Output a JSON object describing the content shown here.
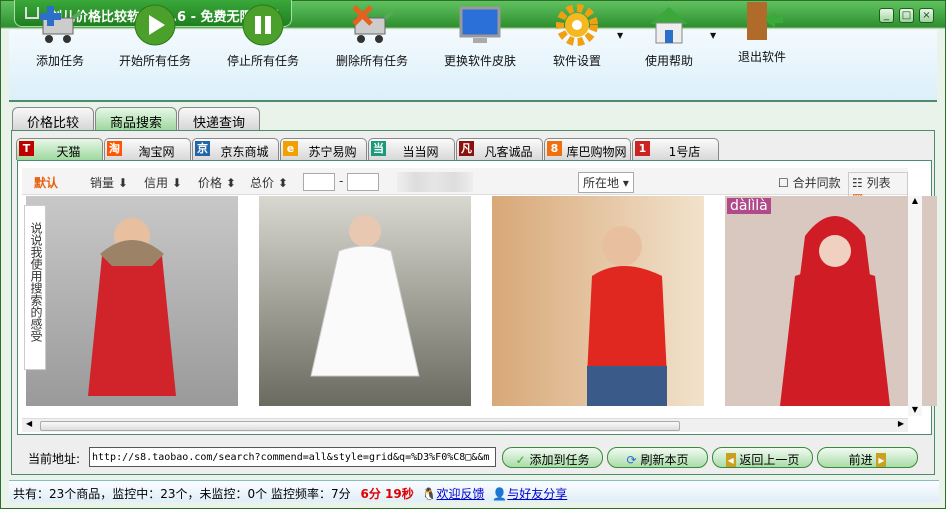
{
  "window": {
    "title": "剑儿价格比较软件V2.6  -  免费无限制版本",
    "min": "_",
    "max": "□",
    "close": "×"
  },
  "toolbar": [
    {
      "label": "添加任务",
      "icon": "add-cart-icon"
    },
    {
      "label": "开始所有任务",
      "icon": "play-icon"
    },
    {
      "label": "停止所有任务",
      "icon": "pause-icon"
    },
    {
      "label": "删除所有任务",
      "icon": "delete-cart-icon"
    },
    {
      "label": "更换软件皮肤",
      "icon": "monitor-icon"
    },
    {
      "label": "软件设置",
      "icon": "gear-icon"
    },
    {
      "label": "使用帮助",
      "icon": "home-icon"
    },
    {
      "label": "退出软件",
      "icon": "exit-door-icon"
    }
  ],
  "main_tabs": [
    "价格比较",
    "商品搜索",
    "快递查询"
  ],
  "store_tabs": [
    {
      "label": "天猫",
      "badge": "T",
      "color": "#c00000"
    },
    {
      "label": "淘宝网",
      "badge": "淘",
      "color": "#ff5500"
    },
    {
      "label": "京东商城",
      "badge": "京",
      "color": "#2266aa"
    },
    {
      "label": "苏宁易购",
      "badge": "e",
      "color": "#f0a000"
    },
    {
      "label": "当当网",
      "badge": "当",
      "color": "#1a9a7a"
    },
    {
      "label": "凡客诚品",
      "badge": "凡",
      "color": "#8b1010"
    },
    {
      "label": "库巴购物网",
      "badge": "8",
      "color": "#f07010"
    },
    {
      "label": "1号店",
      "badge": "1",
      "color": "#cc2222"
    }
  ],
  "filter": {
    "default": "默认",
    "sales": "销量",
    "credit": "信用",
    "price": "价格",
    "total": "总价",
    "dash": "-",
    "location": "所在地",
    "merge": "合并同款",
    "list": "列表"
  },
  "side_note": "说说我使用搜索的感受",
  "products": [
    {
      "brand": ""
    },
    {
      "brand": ""
    },
    {
      "brand": ""
    },
    {
      "brand": "dàlìlà"
    }
  ],
  "address": {
    "label": "当前地址:",
    "value": "http://s8.taobao.com/search?commend=all&style=grid&q=%D3%F0%C8□&&m"
  },
  "buttons": {
    "add": "添加到任务",
    "refresh": "刷新本页",
    "back": "返回上一页",
    "forward": "前进"
  },
  "status": {
    "summary": "共有：23个商品，监控中：23个，未监控：0个  监控频率：7分",
    "countdown": "6分 19秒",
    "feedback": "欢迎反馈",
    "share": "与好友分享"
  }
}
